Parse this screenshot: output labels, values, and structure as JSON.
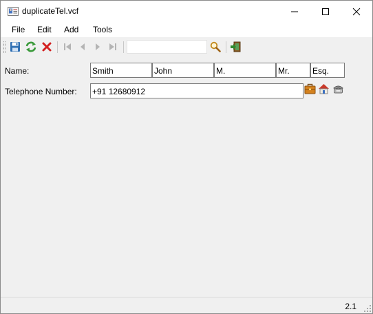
{
  "window": {
    "title": "duplicateTel.vcf",
    "icons": {
      "app": "vcard-icon",
      "minimize": "minimize-icon",
      "maximize": "maximize-icon",
      "close": "close-icon"
    }
  },
  "menu": [
    "File",
    "Edit",
    "Add",
    "Tools"
  ],
  "toolbar": {
    "icons": [
      "save-icon",
      "refresh-icon",
      "delete-icon",
      "first-record-icon",
      "previous-record-icon",
      "next-record-icon",
      "last-record-icon",
      "search-icon",
      "exit-icon"
    ],
    "search_value": ""
  },
  "form": {
    "name_label": "Name:",
    "name_parts": [
      "Smith",
      "John",
      "M.",
      "Mr.",
      "Esq."
    ],
    "telephone_label": "Telephone Number:",
    "telephone_value": "+91 12680912",
    "telephone_icons": [
      "work-briefcase-icon",
      "home-icon",
      "phone-icon"
    ]
  },
  "status": {
    "version": "2.1"
  },
  "colors": {
    "save": "#2f6fb3",
    "refresh": "#3a9a3a",
    "delete": "#d32020",
    "disabled_nav": "#b4b4b4",
    "search": "#c28a1e"
  }
}
